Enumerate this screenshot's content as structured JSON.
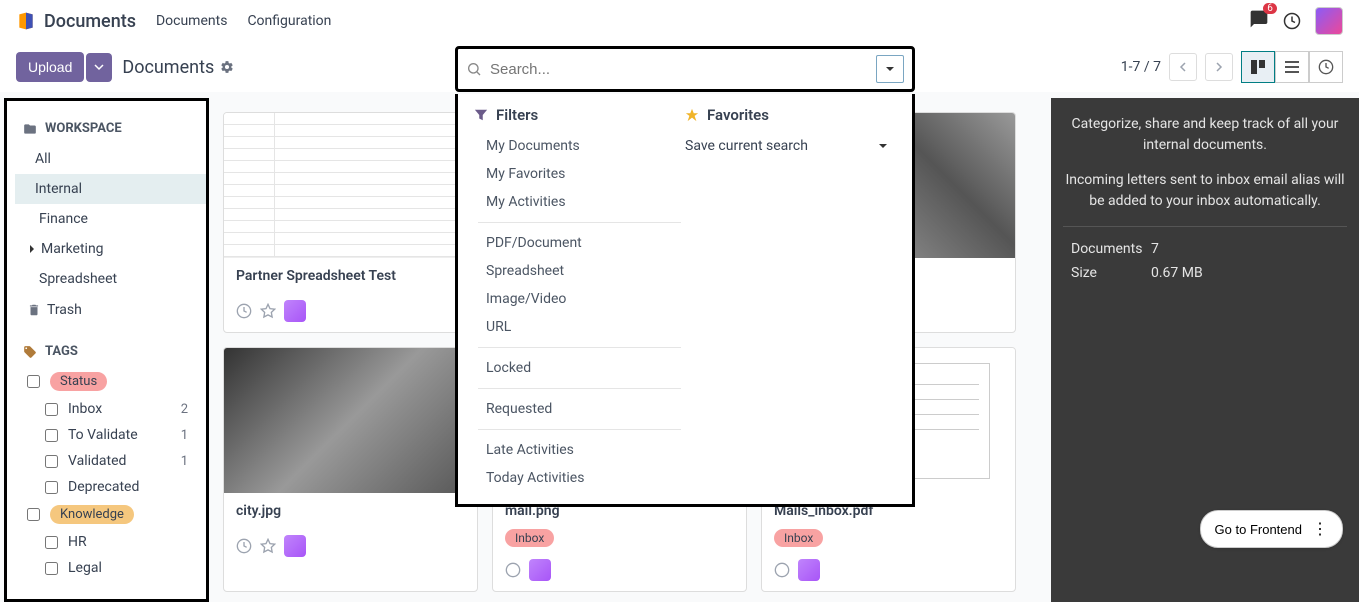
{
  "app_name": "Documents",
  "nav": {
    "documents": "Documents",
    "configuration": "Configuration"
  },
  "notif_count": "6",
  "upload_label": "Upload",
  "breadcrumb": "Documents",
  "search_placeholder": "Search...",
  "pager_text": "1-7 / 7",
  "sidebar": {
    "workspace_header": "WORKSPACE",
    "items": {
      "all": "All",
      "internal": "Internal",
      "finance": "Finance",
      "marketing": "Marketing",
      "spreadsheet": "Spreadsheet"
    },
    "trash": "Trash",
    "tags_header": "TAGS",
    "tags": {
      "status": "Status",
      "inbox": {
        "label": "Inbox",
        "count": "2"
      },
      "to_validate": {
        "label": "To Validate",
        "count": "1"
      },
      "validated": {
        "label": "Validated",
        "count": "1"
      },
      "deprecated": {
        "label": "Deprecated",
        "count": ""
      },
      "knowledge": "Knowledge",
      "hr": "HR",
      "legal": "Legal"
    }
  },
  "cards": {
    "c1": {
      "title": "Partner Spreadsheet Test"
    },
    "c2": {
      "title": "city.jpg"
    },
    "c3": {
      "title": "mail.png",
      "tag": "Inbox"
    },
    "c4": {
      "title": "Mails_inbox.pdf",
      "tag": "Inbox"
    }
  },
  "dropdown": {
    "filters_header": "Filters",
    "favorites_header": "Favorites",
    "save_search": "Save current search",
    "items": {
      "my_docs": "My Documents",
      "my_favs": "My Favorites",
      "my_acts": "My Activities",
      "pdf": "PDF/Document",
      "spreadsheet": "Spreadsheet",
      "imgvid": "Image/Video",
      "url": "URL",
      "locked": "Locked",
      "requested": "Requested",
      "late_act": "Late Activities",
      "today_act": "Today Activities"
    }
  },
  "right": {
    "desc1": "Categorize, share and keep track of all your internal documents.",
    "desc2": "Incoming letters sent to inbox email alias will be added to your inbox automatically.",
    "docs_label": "Documents",
    "docs_val": "7",
    "size_label": "Size",
    "size_val": "0.67 MB"
  },
  "goto_frontend": "Go to Frontend"
}
